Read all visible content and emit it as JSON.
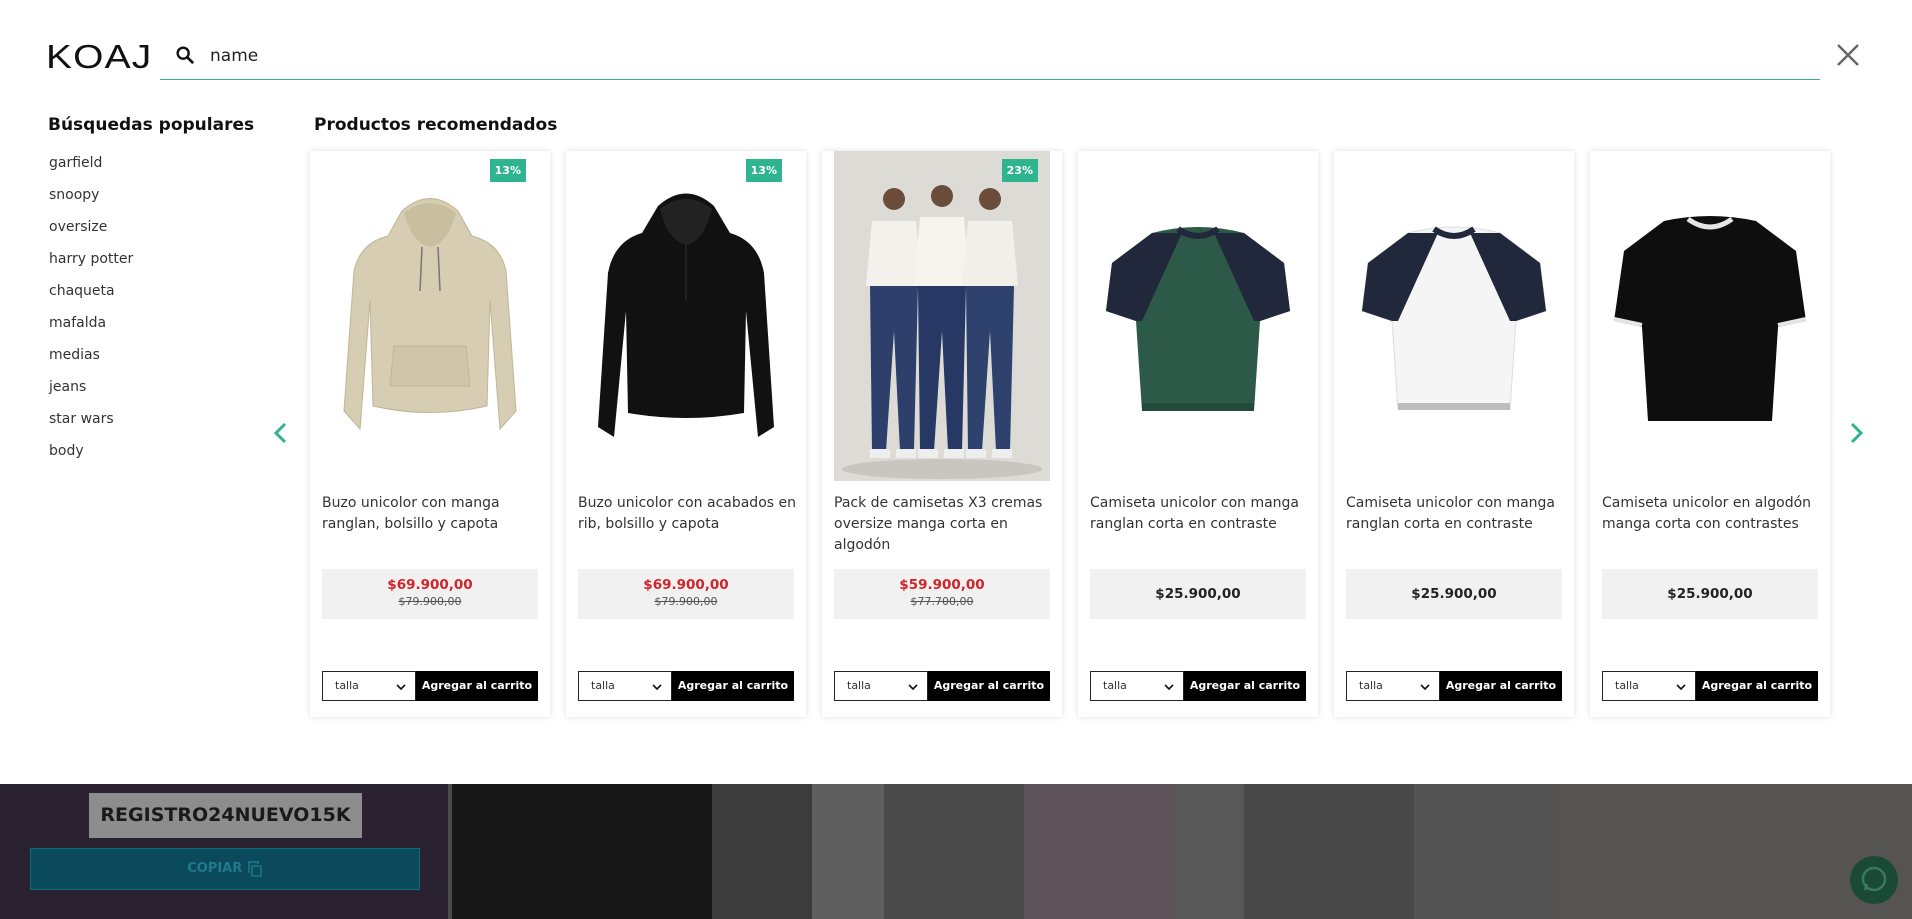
{
  "brand": {
    "logo": "KOAJ",
    "accent": "#2eb48f"
  },
  "search": {
    "value": "name",
    "icon": "search-icon"
  },
  "popular": {
    "title": "Búsquedas populares",
    "items": [
      "garfield",
      "snoopy",
      "oversize",
      "harry potter",
      "chaqueta",
      "mafalda",
      "medias",
      "jeans",
      "star wars",
      "body"
    ]
  },
  "recommended": {
    "title": "Productos recomendados",
    "products": [
      {
        "name": "Buzo unicolor con manga ranglan, bolsillo y capota",
        "badge": "13%",
        "price": "$69.900,00",
        "old_price": "$79.900,00",
        "size_label": "talla",
        "add_label": "Agregar al carrito"
      },
      {
        "name": "Buzo unicolor con acabados en rib, bolsillo y capota",
        "badge": "13%",
        "price": "$69.900,00",
        "old_price": "$79.900,00",
        "size_label": "talla",
        "add_label": "Agregar al carrito"
      },
      {
        "name": "Pack de camisetas X3 cremas oversize manga corta en algodón",
        "badge": "23%",
        "price": "$59.900,00",
        "old_price": "$77.700,00",
        "size_label": "talla",
        "add_label": "Agregar al carrito"
      },
      {
        "name": "Camiseta unicolor con manga ranglan corta en contraste",
        "price": "$25.900,00",
        "size_label": "talla",
        "add_label": "Agregar al carrito"
      },
      {
        "name": "Camiseta unicolor con manga ranglan corta en contraste",
        "price": "$25.900,00",
        "size_label": "talla",
        "add_label": "Agregar al carrito"
      },
      {
        "name": "Camiseta unicolor en algodón manga corta con contrastes",
        "price": "$25.900,00",
        "size_label": "talla",
        "add_label": "Agregar al carrito"
      }
    ]
  },
  "promo": {
    "code": "REGISTRO24NUEVO15K",
    "copy_label": "COPIAR"
  }
}
